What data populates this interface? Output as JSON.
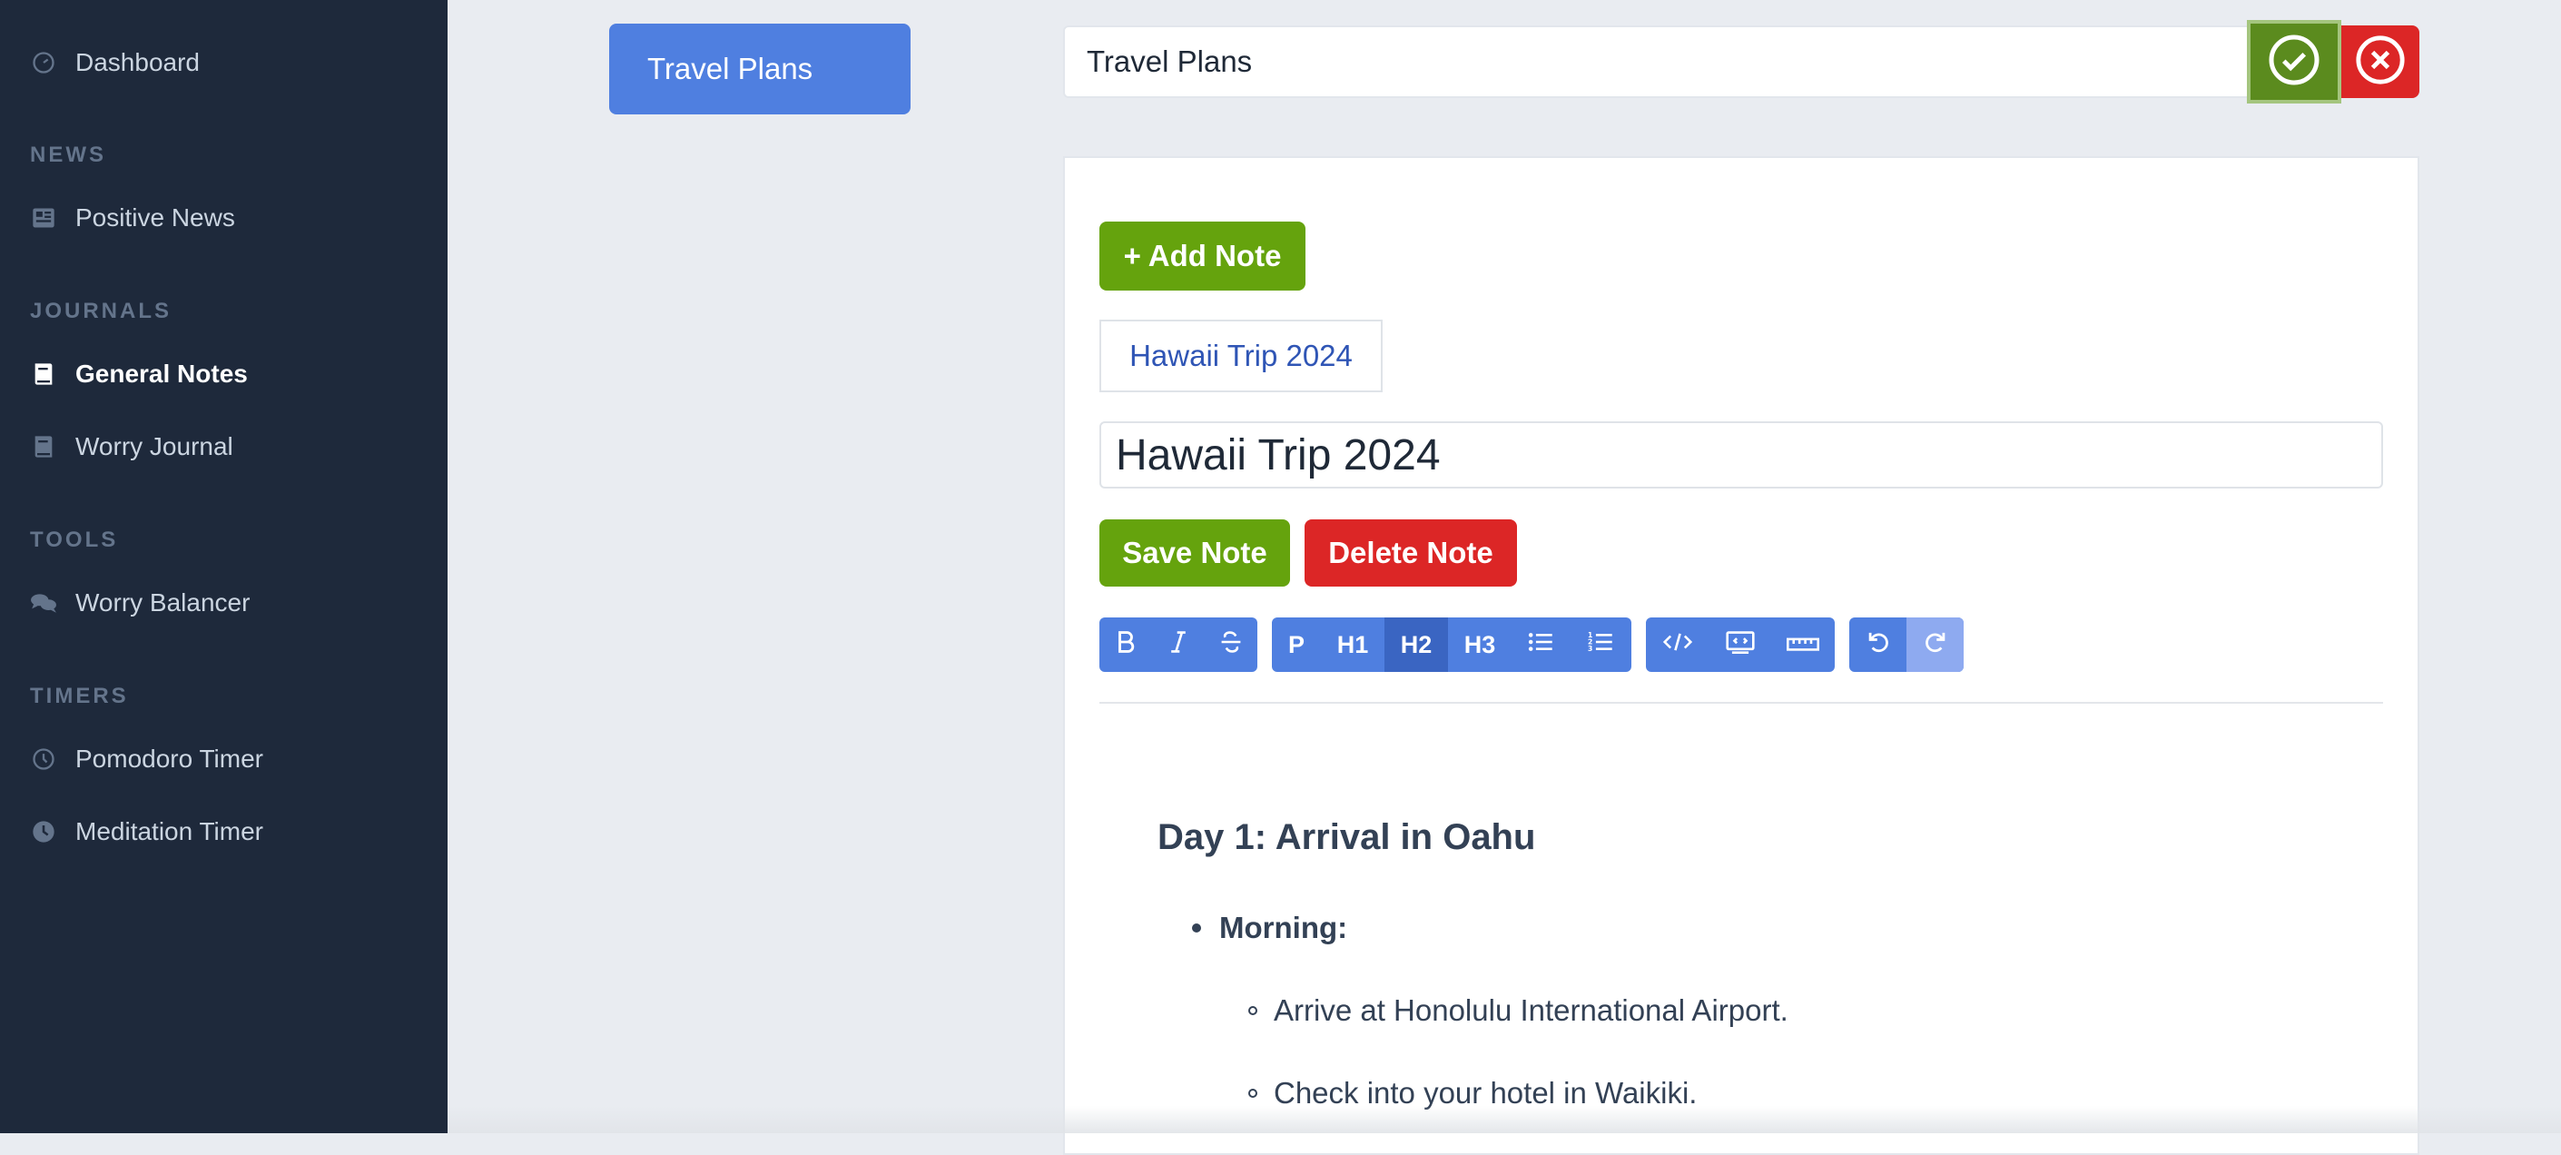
{
  "sidebar": {
    "dashboard": "Dashboard",
    "sections": {
      "news": "NEWS",
      "journals": "JOURNALS",
      "tools": "TOOLS",
      "timers": "TIMERS"
    },
    "items": {
      "positive_news": "Positive News",
      "general_notes": "General Notes",
      "worry_journal": "Worry Journal",
      "worry_balancer": "Worry Balancer",
      "pomodoro_timer": "Pomodoro Timer",
      "meditation_timer": "Meditation Timer"
    },
    "active": "general_notes"
  },
  "journal": {
    "tab_label": "Travel Plans",
    "title_value": "Travel Plans"
  },
  "notes": {
    "add_label": "+ Add Note",
    "chip_label": "Hawaii Trip 2024",
    "title_value": "Hawaii Trip 2024",
    "save_label": "Save Note",
    "delete_label": "Delete Note"
  },
  "toolbar": {
    "p": "P",
    "h1": "H1",
    "h2": "H2",
    "h3": "H3",
    "active_heading": "H2"
  },
  "document": {
    "heading": "Day 1: Arrival in Oahu",
    "item_label": "Morning:",
    "sub_items": [
      "Arrive at Honolulu International Airport.",
      "Check into your hotel in Waikiki."
    ]
  },
  "colors": {
    "sidebar_bg": "#1e293b",
    "accent_blue": "#4f7fe0",
    "success_green": "#65a30d",
    "danger_red": "#dc2626"
  }
}
